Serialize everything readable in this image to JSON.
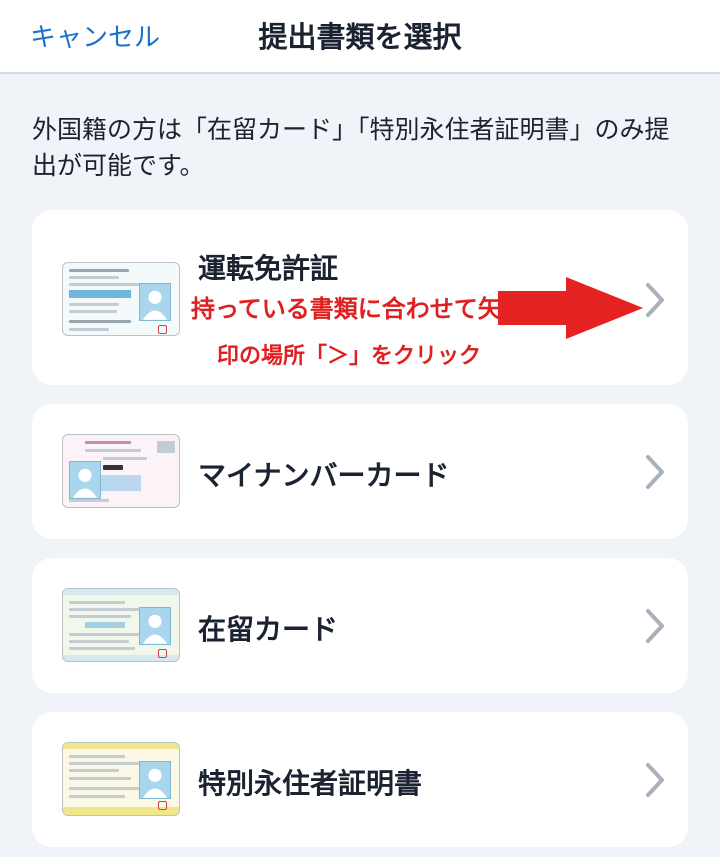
{
  "header": {
    "cancel_label": "キャンセル",
    "title": "提出書類を選択"
  },
  "notice": "外国籍の方は「在留カード」「特別永住者証明書」のみ提出が可能です。",
  "documents": [
    {
      "label": "運転免許証",
      "icon": "drivers-license-image"
    },
    {
      "label": "マイナンバーカード",
      "icon": "my-number-card-image"
    },
    {
      "label": "在留カード",
      "icon": "residence-card-image"
    },
    {
      "label": "特別永住者証明書",
      "icon": "special-permanent-resident-certificate-image"
    }
  ],
  "annotation": {
    "line1": "持っている書類に合わせて矢",
    "line2": "印の場所「＞」をクリック",
    "color": "#e02020"
  },
  "colors": {
    "accent": "#1a73c9",
    "background": "#f0f3f7",
    "card": "#ffffff",
    "chevron": "#a9b2bb"
  }
}
